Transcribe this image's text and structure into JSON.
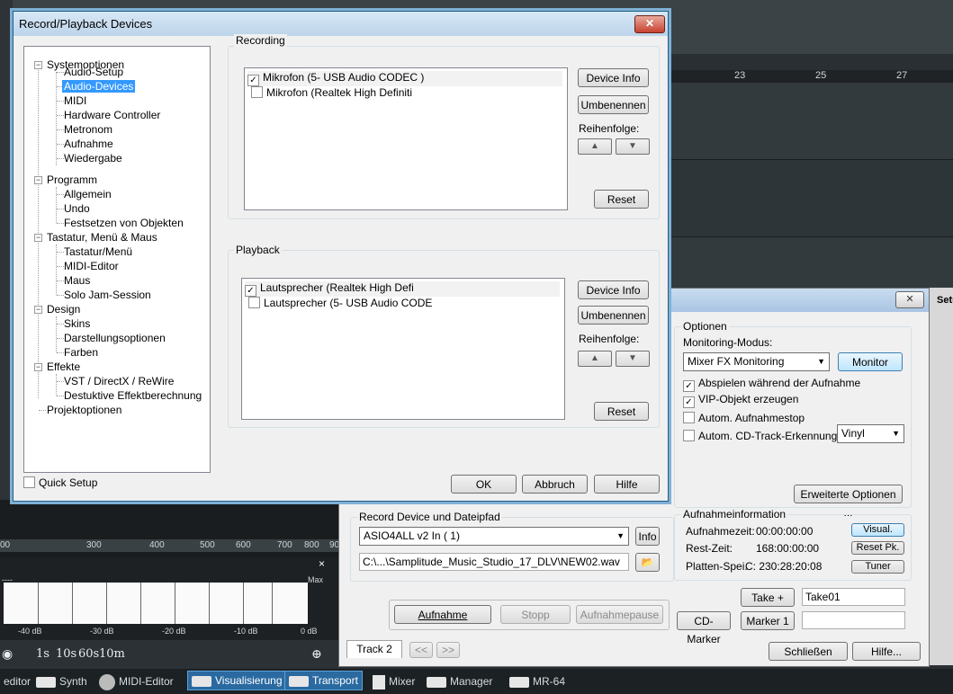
{
  "background": {
    "ruler_ticks": [
      "23",
      "25",
      "27"
    ],
    "meter_scale": [
      "00",
      "300",
      "400",
      "500",
      "600",
      "700",
      "800",
      "90"
    ],
    "spectrum": {
      "close": "×",
      "max_label": "Max",
      "min_label": "----",
      "db_labels": [
        "-40 dB",
        "-30 dB",
        "-20 dB",
        "-10 dB",
        "0 dB"
      ]
    },
    "timebar": {
      "items": [
        "1s",
        "10s",
        "60s",
        "10m"
      ]
    },
    "taskbar": {
      "items": [
        {
          "label": "editor",
          "icon": "editor-icon"
        },
        {
          "label": "Synth",
          "icon": "synth-icon"
        },
        {
          "label": "MIDI-Editor",
          "icon": "midi-editor-icon"
        },
        {
          "label": "Visualisierung",
          "icon": "visualization-icon",
          "active": true
        },
        {
          "label": "Transport",
          "icon": "transport-icon",
          "active": true
        },
        {
          "label": "Mixer",
          "icon": "mixer-icon"
        },
        {
          "label": "Manager",
          "icon": "manager-icon"
        },
        {
          "label": "MR-64",
          "icon": "mr64-icon"
        }
      ]
    },
    "right_panel_label": "Setu"
  },
  "transport": {
    "close": "✕",
    "optionen": {
      "title": "Optionen",
      "monitoring_label": "Monitoring-Modus:",
      "monitoring_value": "Mixer FX Monitoring",
      "monitor_button": "Monitor",
      "checks": [
        {
          "label": "Abspielen während der Aufnahme",
          "checked": true
        },
        {
          "label": "VIP-Objekt erzeugen",
          "checked": true
        },
        {
          "label": "Autom. Aufnahmestop",
          "checked": false
        },
        {
          "label": "Autom. CD-Track-Erkennung",
          "checked": false
        }
      ],
      "cd_mode": "Vinyl",
      "advanced_button": "Erweiterte Optionen ..."
    },
    "device": {
      "title": "Record Device und Dateipfad",
      "device_value": "ASIO4ALL v2 In ( 1)",
      "info_button": "Info",
      "path": "C:\\...\\Samplitude_Music_Studio_17_DLV\\NEW02.wav"
    },
    "info": {
      "title": "Aufnahmeinformation",
      "rows": [
        {
          "label": "Aufnahmezeit:",
          "value": "00:00:00:00",
          "button": "Visual."
        },
        {
          "label": "Rest-Zeit:",
          "value": "168:00:00:00",
          "button": "Reset Pk."
        },
        {
          "label": "Platten-Spei.",
          "value": "C: 230:28:20:08",
          "button": "Tuner"
        }
      ]
    },
    "take_button": "Take +",
    "take_value": "Take01",
    "buttons": {
      "aufnahme": "Aufnahme",
      "stopp": "Stopp",
      "pause": "Aufnahmepause",
      "cd_marker": "CD-Marker",
      "marker": "Marker 1"
    },
    "track_tab": "Track 2",
    "nav_prev": "<<",
    "nav_next": ">>",
    "schliessen": "Schließen",
    "hilfe": "Hilfe..."
  },
  "dialog": {
    "title": "Record/Playback Devices",
    "close": "✕",
    "tree": [
      {
        "label": "Systemoptionen",
        "level": 0
      },
      {
        "label": "Audio-Setup",
        "level": 1
      },
      {
        "label": "Audio-Devices",
        "level": 1,
        "selected": true
      },
      {
        "label": "MIDI",
        "level": 1
      },
      {
        "label": "Hardware Controller",
        "level": 1
      },
      {
        "label": "Metronom",
        "level": 1
      },
      {
        "label": "Aufnahme",
        "level": 1
      },
      {
        "label": "Wiedergabe",
        "level": 1
      },
      {
        "label": "Programm",
        "level": 0
      },
      {
        "label": "Allgemein",
        "level": 1
      },
      {
        "label": "Undo",
        "level": 1
      },
      {
        "label": "Festsetzen von Objekten",
        "level": 1
      },
      {
        "label": "Tastatur, Menü & Maus",
        "level": 0
      },
      {
        "label": "Tastatur/Menü",
        "level": 1
      },
      {
        "label": "MIDI-Editor",
        "level": 1
      },
      {
        "label": "Maus",
        "level": 1
      },
      {
        "label": "Solo Jam-Session",
        "level": 1
      },
      {
        "label": "Design",
        "level": 0
      },
      {
        "label": "Skins",
        "level": 1
      },
      {
        "label": "Darstellungsoptionen",
        "level": 1
      },
      {
        "label": "Farben",
        "level": 1
      },
      {
        "label": "Effekte",
        "level": 0
      },
      {
        "label": "VST / DirectX / ReWire",
        "level": 1
      },
      {
        "label": "Destuktive Effektberechnung",
        "level": 1
      },
      {
        "label": "Projektoptionen",
        "level": 0,
        "leaf": true
      }
    ],
    "quick_setup": "Quick Setup",
    "recording": {
      "title": "Recording",
      "devices": [
        {
          "label": "Mikrofon (5- USB Audio CODEC )",
          "checked": true
        },
        {
          "label": "Mikrofon (Realtek High Definiti",
          "checked": false
        }
      ],
      "device_info": "Device Info",
      "rename": "Umbenennen",
      "order_label": "Reihenfolge:",
      "reset": "Reset"
    },
    "playback": {
      "title": "Playback",
      "devices": [
        {
          "label": "Lautsprecher (Realtek High Defi",
          "checked": true
        },
        {
          "label": "Lautsprecher (5- USB Audio CODE",
          "checked": false
        }
      ],
      "device_info": "Device Info",
      "rename": "Umbenennen",
      "order_label": "Reihenfolge:",
      "reset": "Reset"
    },
    "buttons": {
      "ok": "OK",
      "cancel": "Abbruch",
      "help": "Hilfe"
    }
  }
}
